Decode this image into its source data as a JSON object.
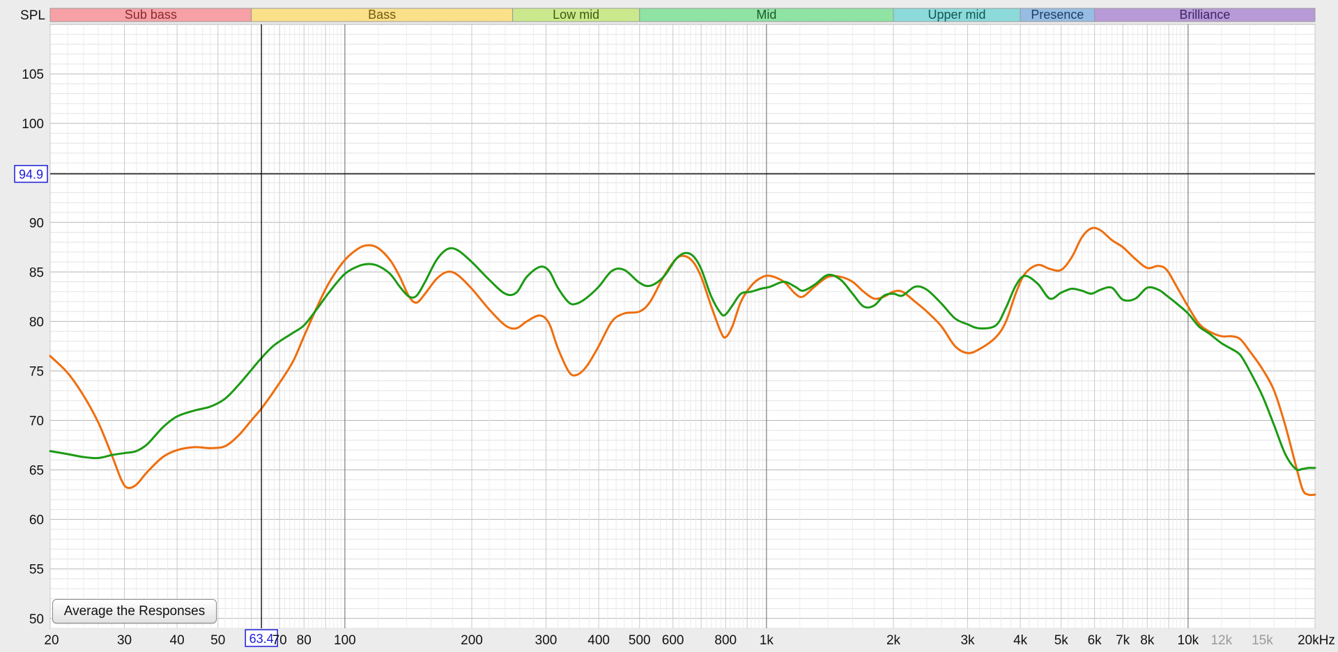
{
  "chart_data": {
    "type": "line",
    "ylabel": "SPL",
    "xscale": "log",
    "xlim": [
      20,
      20000
    ],
    "ylim": [
      49,
      110
    ],
    "y_ticks": [
      50,
      55,
      60,
      65,
      70,
      75,
      80,
      85,
      90,
      95,
      100,
      105
    ],
    "y_tick_labels": [
      "50",
      "55",
      "60",
      "65",
      "70",
      "75",
      "80",
      "85",
      "90",
      "100",
      "105"
    ],
    "x_ticks": [
      {
        "value": 20,
        "label": "20"
      },
      {
        "value": 30,
        "label": "30"
      },
      {
        "value": 40,
        "label": "40"
      },
      {
        "value": 50,
        "label": "50"
      },
      {
        "value": 70,
        "label": "70"
      },
      {
        "value": 80,
        "label": "80"
      },
      {
        "value": 100,
        "label": "100"
      },
      {
        "value": 200,
        "label": "200"
      },
      {
        "value": 300,
        "label": "300"
      },
      {
        "value": 400,
        "label": "400"
      },
      {
        "value": 500,
        "label": "500"
      },
      {
        "value": 600,
        "label": "600"
      },
      {
        "value": 800,
        "label": "800"
      },
      {
        "value": 1000,
        "label": "1k"
      },
      {
        "value": 2000,
        "label": "2k"
      },
      {
        "value": 3000,
        "label": "3k"
      },
      {
        "value": 4000,
        "label": "4k"
      },
      {
        "value": 5000,
        "label": "5k"
      },
      {
        "value": 6000,
        "label": "6k"
      },
      {
        "value": 7000,
        "label": "7k"
      },
      {
        "value": 8000,
        "label": "8k"
      },
      {
        "value": 10000,
        "label": "10k"
      },
      {
        "value": 12000,
        "label": "12k",
        "dim": true
      },
      {
        "value": 15000,
        "label": "15k",
        "dim": true
      },
      {
        "value": 20000,
        "label": "20kHz"
      }
    ],
    "bands": [
      {
        "label": "Sub bass",
        "from": 20,
        "to": 60,
        "color": "#f7a1a6",
        "text_color": "#8a2a2f"
      },
      {
        "label": "Bass",
        "from": 60,
        "to": 250,
        "color": "#fbe08a",
        "text_color": "#6e5a10"
      },
      {
        "label": "Low mid",
        "from": 250,
        "to": 500,
        "color": "#cbe98c",
        "text_color": "#3f5a10"
      },
      {
        "label": "Mid",
        "from": 500,
        "to": 2000,
        "color": "#8fe3a3",
        "text_color": "#1c5a2c"
      },
      {
        "label": "Upper mid",
        "from": 2000,
        "to": 4000,
        "color": "#8cdada",
        "text_color": "#145656"
      },
      {
        "label": "Presence",
        "from": 4000,
        "to": 6000,
        "color": "#97bde4",
        "text_color": "#1c3f66"
      },
      {
        "label": "Brilliance",
        "from": 6000,
        "to": 20000,
        "color": "#b89ad8",
        "text_color": "#3c2463"
      }
    ],
    "cursor": {
      "x": 63.4,
      "y": 94.9,
      "x_label": "63.4",
      "y_label": "94.9"
    },
    "series": [
      {
        "color": "#ee6e0e",
        "points": [
          [
            20,
            76.5
          ],
          [
            22,
            74.8
          ],
          [
            24,
            72.5
          ],
          [
            26,
            69.8
          ],
          [
            28,
            66.5
          ],
          [
            29.5,
            64.0
          ],
          [
            30.5,
            63.2
          ],
          [
            32,
            63.5
          ],
          [
            34,
            64.8
          ],
          [
            37,
            66.3
          ],
          [
            40,
            67.0
          ],
          [
            44,
            67.3
          ],
          [
            48,
            67.2
          ],
          [
            52,
            67.4
          ],
          [
            56,
            68.5
          ],
          [
            60,
            70.0
          ],
          [
            63.4,
            71.2
          ],
          [
            68,
            73.0
          ],
          [
            75,
            75.8
          ],
          [
            80,
            78.5
          ],
          [
            86,
            81.5
          ],
          [
            92,
            84.0
          ],
          [
            100,
            86.2
          ],
          [
            108,
            87.4
          ],
          [
            114,
            87.7
          ],
          [
            120,
            87.4
          ],
          [
            128,
            86.2
          ],
          [
            135,
            84.5
          ],
          [
            142,
            82.5
          ],
          [
            148,
            81.9
          ],
          [
            155,
            82.8
          ],
          [
            165,
            84.3
          ],
          [
            175,
            85.0
          ],
          [
            185,
            84.7
          ],
          [
            200,
            83.3
          ],
          [
            220,
            81.2
          ],
          [
            240,
            79.6
          ],
          [
            255,
            79.3
          ],
          [
            270,
            80.0
          ],
          [
            290,
            80.6
          ],
          [
            305,
            79.8
          ],
          [
            320,
            77.3
          ],
          [
            340,
            74.9
          ],
          [
            355,
            74.6
          ],
          [
            375,
            75.5
          ],
          [
            400,
            77.5
          ],
          [
            430,
            80.0
          ],
          [
            460,
            80.8
          ],
          [
            500,
            81.0
          ],
          [
            530,
            82.0
          ],
          [
            570,
            84.5
          ],
          [
            610,
            86.3
          ],
          [
            640,
            86.6
          ],
          [
            670,
            86.0
          ],
          [
            700,
            84.5
          ],
          [
            740,
            81.5
          ],
          [
            780,
            78.9
          ],
          [
            800,
            78.4
          ],
          [
            830,
            79.5
          ],
          [
            870,
            82.0
          ],
          [
            920,
            83.6
          ],
          [
            970,
            84.4
          ],
          [
            1020,
            84.6
          ],
          [
            1100,
            84.0
          ],
          [
            1170,
            82.8
          ],
          [
            1220,
            82.5
          ],
          [
            1300,
            83.5
          ],
          [
            1400,
            84.5
          ],
          [
            1500,
            84.5
          ],
          [
            1600,
            84.0
          ],
          [
            1700,
            83.0
          ],
          [
            1800,
            82.3
          ],
          [
            1900,
            82.5
          ],
          [
            2000,
            83.0
          ],
          [
            2100,
            83.0
          ],
          [
            2250,
            82.0
          ],
          [
            2400,
            81.0
          ],
          [
            2600,
            79.5
          ],
          [
            2800,
            77.5
          ],
          [
            3000,
            76.8
          ],
          [
            3200,
            77.2
          ],
          [
            3500,
            78.4
          ],
          [
            3700,
            80.0
          ],
          [
            3900,
            82.8
          ],
          [
            4100,
            84.8
          ],
          [
            4400,
            85.7
          ],
          [
            4700,
            85.3
          ],
          [
            5000,
            85.2
          ],
          [
            5300,
            86.5
          ],
          [
            5600,
            88.5
          ],
          [
            5900,
            89.4
          ],
          [
            6200,
            89.2
          ],
          [
            6600,
            88.2
          ],
          [
            7000,
            87.5
          ],
          [
            7500,
            86.3
          ],
          [
            8000,
            85.4
          ],
          [
            8500,
            85.6
          ],
          [
            8900,
            85.2
          ],
          [
            9400,
            83.5
          ],
          [
            10000,
            81.5
          ],
          [
            10600,
            79.8
          ],
          [
            11200,
            79.0
          ],
          [
            12000,
            78.5
          ],
          [
            12700,
            78.5
          ],
          [
            13300,
            78.2
          ],
          [
            14000,
            77.0
          ],
          [
            15000,
            75.2
          ],
          [
            16000,
            73.0
          ],
          [
            17000,
            69.5
          ],
          [
            18000,
            65.5
          ],
          [
            18700,
            63.0
          ],
          [
            19300,
            62.5
          ],
          [
            20000,
            62.5
          ]
        ]
      },
      {
        "color": "#1c9a14",
        "points": [
          [
            20,
            66.9
          ],
          [
            22,
            66.6
          ],
          [
            24,
            66.3
          ],
          [
            26,
            66.2
          ],
          [
            28,
            66.5
          ],
          [
            30,
            66.7
          ],
          [
            32,
            66.9
          ],
          [
            34,
            67.6
          ],
          [
            37,
            69.3
          ],
          [
            40,
            70.4
          ],
          [
            44,
            71.0
          ],
          [
            48,
            71.4
          ],
          [
            52,
            72.2
          ],
          [
            56,
            73.6
          ],
          [
            60,
            75.1
          ],
          [
            63.4,
            76.3
          ],
          [
            68,
            77.6
          ],
          [
            75,
            78.8
          ],
          [
            80,
            79.6
          ],
          [
            86,
            81.3
          ],
          [
            92,
            83.0
          ],
          [
            100,
            84.8
          ],
          [
            108,
            85.6
          ],
          [
            114,
            85.8
          ],
          [
            120,
            85.6
          ],
          [
            128,
            84.8
          ],
          [
            135,
            83.5
          ],
          [
            142,
            82.5
          ],
          [
            148,
            82.6
          ],
          [
            155,
            84.0
          ],
          [
            165,
            86.2
          ],
          [
            175,
            87.3
          ],
          [
            185,
            87.2
          ],
          [
            200,
            86.0
          ],
          [
            220,
            84.2
          ],
          [
            240,
            82.8
          ],
          [
            255,
            82.9
          ],
          [
            270,
            84.5
          ],
          [
            290,
            85.5
          ],
          [
            305,
            85.1
          ],
          [
            320,
            83.4
          ],
          [
            340,
            81.9
          ],
          [
            355,
            81.8
          ],
          [
            375,
            82.4
          ],
          [
            400,
            83.5
          ],
          [
            430,
            85.1
          ],
          [
            460,
            85.2
          ],
          [
            500,
            83.9
          ],
          [
            530,
            83.6
          ],
          [
            570,
            84.5
          ],
          [
            610,
            86.3
          ],
          [
            640,
            86.9
          ],
          [
            670,
            86.6
          ],
          [
            700,
            85.3
          ],
          [
            740,
            82.5
          ],
          [
            780,
            80.8
          ],
          [
            800,
            80.7
          ],
          [
            830,
            81.6
          ],
          [
            870,
            82.8
          ],
          [
            920,
            83.0
          ],
          [
            970,
            83.3
          ],
          [
            1020,
            83.5
          ],
          [
            1100,
            84.0
          ],
          [
            1170,
            83.5
          ],
          [
            1220,
            83.1
          ],
          [
            1300,
            83.7
          ],
          [
            1400,
            84.7
          ],
          [
            1500,
            84.2
          ],
          [
            1600,
            82.8
          ],
          [
            1700,
            81.5
          ],
          [
            1800,
            81.6
          ],
          [
            1900,
            82.6
          ],
          [
            2000,
            82.8
          ],
          [
            2100,
            82.6
          ],
          [
            2250,
            83.5
          ],
          [
            2400,
            83.2
          ],
          [
            2600,
            81.8
          ],
          [
            2800,
            80.3
          ],
          [
            3000,
            79.7
          ],
          [
            3200,
            79.3
          ],
          [
            3500,
            79.6
          ],
          [
            3700,
            81.4
          ],
          [
            3900,
            83.6
          ],
          [
            4100,
            84.6
          ],
          [
            4400,
            83.8
          ],
          [
            4700,
            82.3
          ],
          [
            5000,
            82.9
          ],
          [
            5300,
            83.3
          ],
          [
            5600,
            83.1
          ],
          [
            5900,
            82.8
          ],
          [
            6200,
            83.2
          ],
          [
            6600,
            83.4
          ],
          [
            7000,
            82.2
          ],
          [
            7500,
            82.3
          ],
          [
            8000,
            83.4
          ],
          [
            8500,
            83.2
          ],
          [
            8900,
            82.6
          ],
          [
            9400,
            81.8
          ],
          [
            10000,
            80.8
          ],
          [
            10600,
            79.5
          ],
          [
            11200,
            78.8
          ],
          [
            12000,
            77.8
          ],
          [
            12700,
            77.2
          ],
          [
            13300,
            76.6
          ],
          [
            14000,
            75.0
          ],
          [
            15000,
            72.5
          ],
          [
            16000,
            69.5
          ],
          [
            17000,
            66.6
          ],
          [
            18000,
            65.1
          ],
          [
            18700,
            65.1
          ],
          [
            19300,
            65.2
          ],
          [
            20000,
            65.2
          ]
        ]
      }
    ]
  },
  "button": {
    "label": "Average the Responses"
  }
}
